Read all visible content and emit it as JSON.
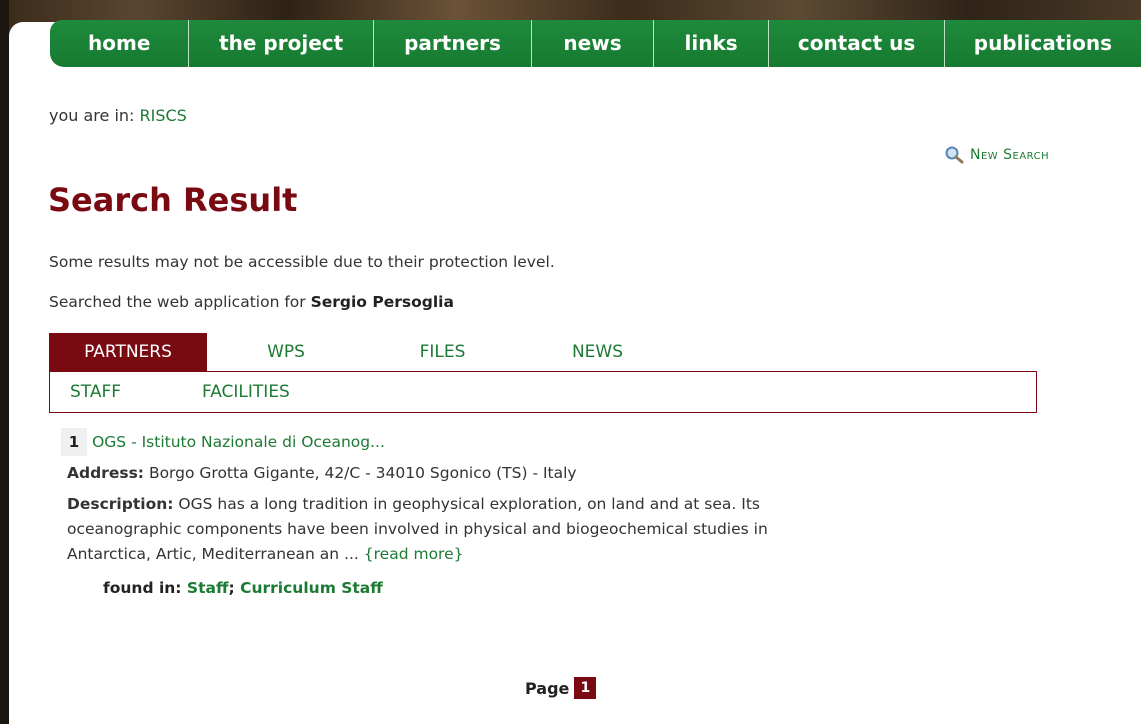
{
  "nav": [
    "home",
    "the project",
    "partners",
    "news",
    "links",
    "contact us",
    "publications"
  ],
  "breadcrumb": {
    "prefix": "you are in:",
    "current": "RISCS"
  },
  "new_search": "New Search",
  "title": "Search Result",
  "note": "Some results may not be accessible due to their protection level.",
  "searched": {
    "prefix": "Searched the web application for",
    "query": "Sergio Persoglia"
  },
  "tabs": [
    "PARTNERS",
    "WPS",
    "FILES",
    "NEWS"
  ],
  "subtabs": [
    "STAFF",
    "FACILITIES"
  ],
  "result": {
    "number": "1",
    "title": "OGS - Istituto Nazionale di Oceanog...",
    "address_label": "Address:",
    "address": "Borgo Grotta Gigante, 42/C - 34010 Sgonico (TS) - Italy",
    "description_label": "Description:",
    "description": "OGS has a long tradition in geophysical exploration, on land and at sea. Its oceanographic components have been involved in physical and biogeochemical studies in Antarctica, Artic, Mediterranean an ...",
    "read_more": "{read more}",
    "found_label": "found in:",
    "found_1": "Staff",
    "found_sep": ";",
    "found_2": "Curriculum Staff"
  },
  "pager": {
    "label": "Page",
    "current": "1"
  }
}
